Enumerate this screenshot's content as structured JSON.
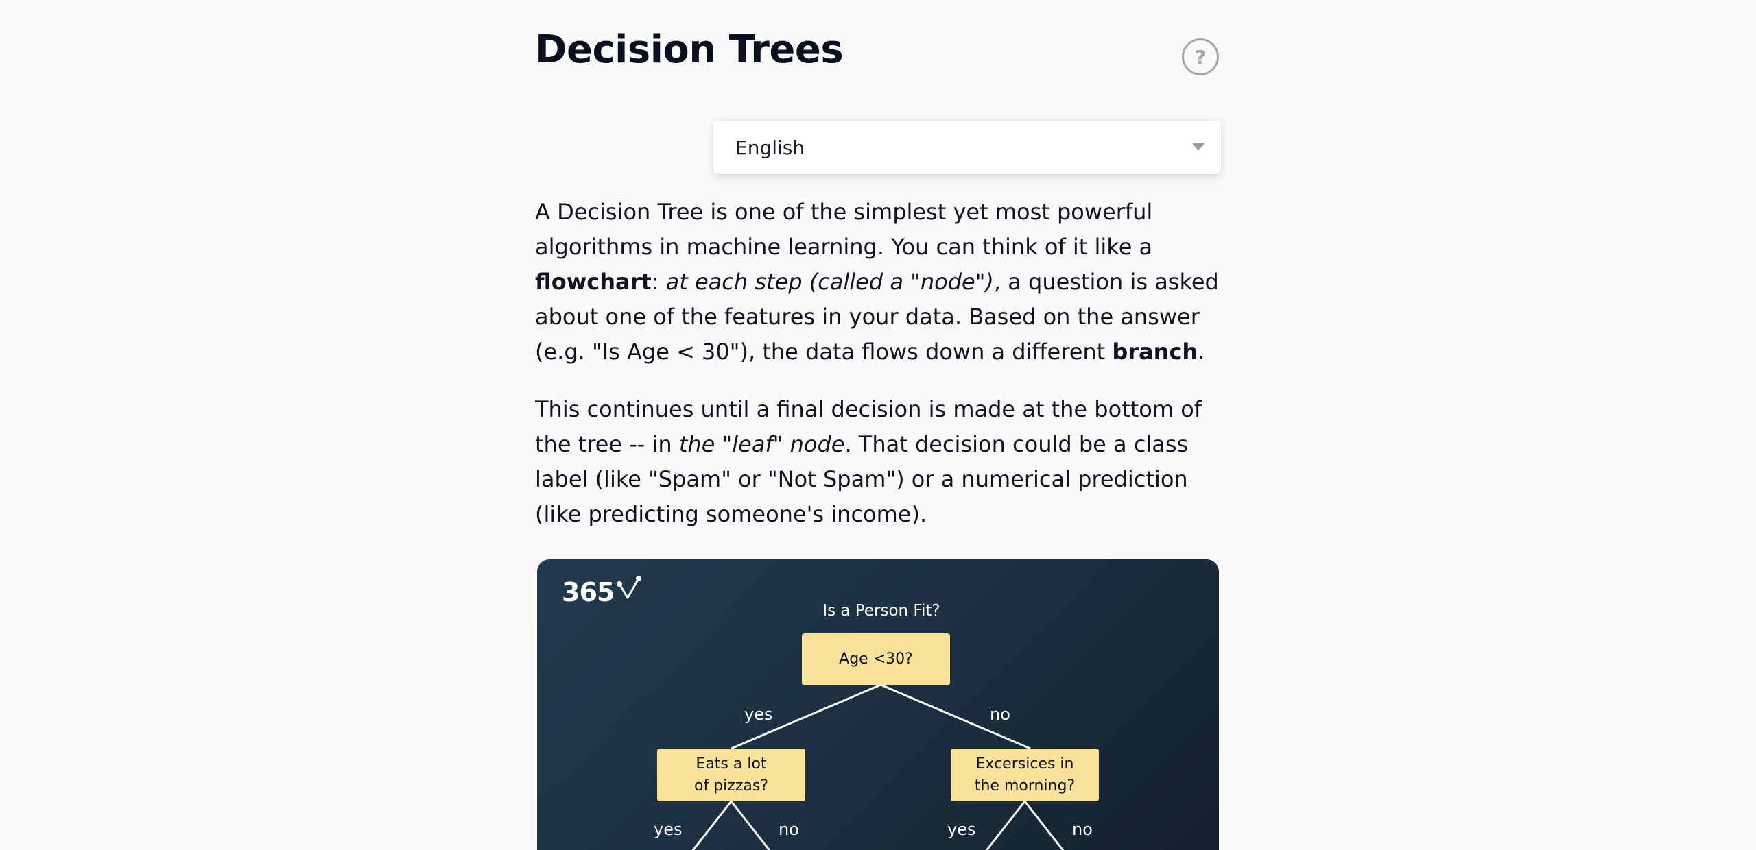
{
  "header": {
    "title": "Decision Trees",
    "help_icon_glyph": "?"
  },
  "language_select": {
    "selected": "English",
    "icon": "chevron-down-icon"
  },
  "article": {
    "p1": {
      "t1": "A Decision Tree is one of the simplest yet most powerful algorithms in machine learning. You can think of it like a ",
      "b1": "flowchart",
      "t2": ": ",
      "i1": "at each step (called a \"node\")",
      "t3": ", a question is asked about one of the features in your data. Based on the answer (e.g. \"Is Age < 30\"), the data flows down a different ",
      "b2": "branch",
      "t4": "."
    },
    "p2": {
      "t1": "This continues until a final decision is made at the bottom of the tree -- in ",
      "i1": "the \"leaf\" node",
      "t2": ". That decision could be a class label (like \"Spam\" or \"Not Spam\") or a numerical prediction (like predicting someone's income)."
    }
  },
  "diagram": {
    "logo_text": "365",
    "title": "Is a Person Fit?",
    "root": "Age <30?",
    "left_node": {
      "line1": "Eats a lot",
      "line2": "of pizzas?"
    },
    "right_node": {
      "line1": "Excersices in",
      "line2": "the morning?"
    },
    "labels": {
      "root_yes": "yes",
      "root_no": "no",
      "left_yes": "yes",
      "left_no": "no",
      "right_yes": "yes",
      "right_no": "no"
    },
    "colors": {
      "background": "#1c2f41",
      "node": "#f9e29b",
      "line": "#ffffff"
    }
  }
}
